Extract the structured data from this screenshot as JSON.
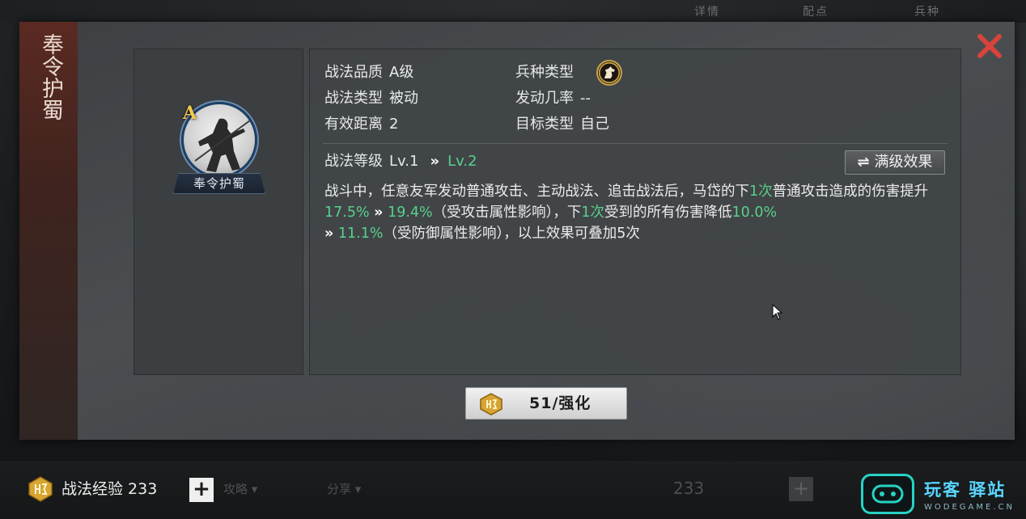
{
  "top_tabs": [
    "详情",
    "配点",
    "兵种"
  ],
  "title": "奉令护蜀",
  "skill": {
    "grade": "A",
    "name": "奉令护蜀"
  },
  "attributes": {
    "quality_label": "战法品质",
    "quality_value": "A级",
    "type_label": "战法类型",
    "type_value": "被动",
    "range_label": "有效距离",
    "range_value": "2",
    "troop_label": "兵种类型",
    "troop_icon": "horse-icon",
    "rate_label": "发动几率",
    "rate_value": "--",
    "target_label": "目标类型",
    "target_value": "自己"
  },
  "level": {
    "label": "战法等级",
    "current": "Lv.1",
    "arrow": "»",
    "next": "Lv.2",
    "max_button": "满级效果"
  },
  "description": {
    "p1": "战斗中，任意友军发动普通攻击、主动战法、追击战法后，马岱的下",
    "n1": "1次",
    "p2": "普通攻击造成的伤害提升",
    "v1a": "17.5%",
    "arrow": "»",
    "v1b": "19.4%",
    "p3": "（受攻击属性影响），下",
    "n2": "1次",
    "p4": "受到的所有伤害降低",
    "v2a": "10.0%",
    "v2b": "11.1%",
    "p5": "（受防御属性影响），以上效果可叠加5次"
  },
  "upgrade_button": "51/强化",
  "bottom": {
    "exp_label": "战法经验 233",
    "plus": "+",
    "faded_1": "攻略 ▾",
    "faded_2": "分享 ▾",
    "faded_3": "233",
    "faded_plus": "+"
  },
  "watermark": {
    "cn": "玩客 驿站",
    "en": "WODEGAME.CN"
  },
  "colors": {
    "accent_green": "#58d08a",
    "close_red": "#d8433b",
    "grade_gold": "#f2c94c",
    "banner": "#5a2a22"
  }
}
